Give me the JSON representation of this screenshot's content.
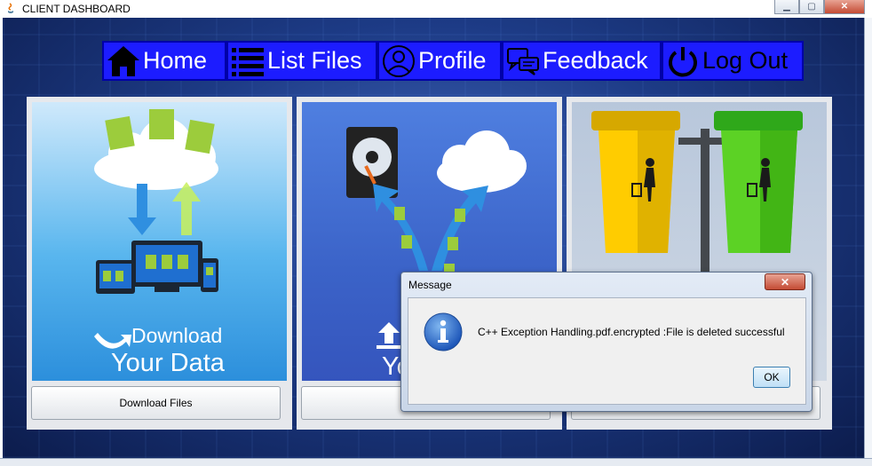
{
  "window": {
    "title": "CLIENT DASHBOARD",
    "icon": "java-icon"
  },
  "nav": [
    {
      "label": "Home",
      "icon": "home-icon"
    },
    {
      "label": "List Files",
      "icon": "list-icon"
    },
    {
      "label": "Profile",
      "icon": "user-icon"
    },
    {
      "label": "Feedback",
      "icon": "feedback-icon"
    },
    {
      "label": "Log Out",
      "icon": "power-icon"
    }
  ],
  "panels": [
    {
      "art_line1": "Download",
      "art_line2": "Your Data",
      "button": "Download Files"
    },
    {
      "art_line1": "",
      "art_line2": "Yo",
      "button": ""
    },
    {
      "art_line1": "",
      "art_line2": "",
      "button": ""
    }
  ],
  "dialog": {
    "title": "Message",
    "message": "C++ Exception Handling.pdf.encrypted :File is deleted successful",
    "ok_label": "OK",
    "icon": "info-icon"
  },
  "colors": {
    "nav_bg": "#1c1cff",
    "nav_border": "#0000a8",
    "close_red": "#c44b34"
  }
}
